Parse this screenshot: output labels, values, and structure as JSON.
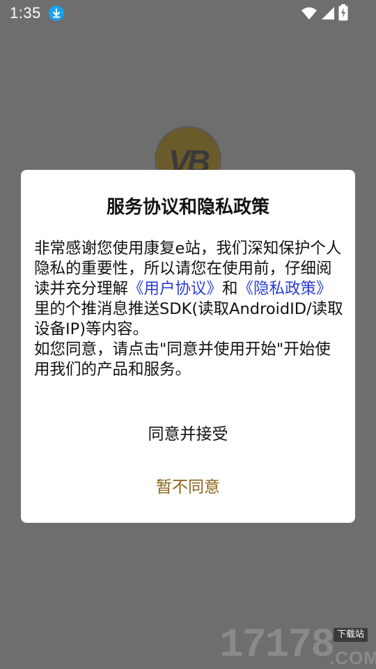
{
  "status_bar": {
    "time": "1:35"
  },
  "background_logo": {
    "text": "VB"
  },
  "dialog": {
    "title": "服务协议和隐私政策",
    "body": {
      "part1": "非常感谢您使用康复e站，我们深知保护个人隐私的重要性，所以请您在使用前，仔细阅读并充分理解",
      "link_user_agreement": "《用户协议》",
      "part2": "和",
      "link_privacy_policy": "《隐私政策》",
      "part3": "里的个推消息推送SDK(读取AndroidID/读取设备IP)等内容。",
      "part4": "如您同意，请点击\"同意并使用开始\"开始使用我们的产品和服务。"
    },
    "accept_label": "同意并接受",
    "decline_label": "暂不同意"
  },
  "watermark": {
    "digits": "17178",
    "tag": "下载站",
    "suffix": ".COM"
  },
  "colors": {
    "overlay_bg": "#6e6e6e",
    "link": "#2b3fd6",
    "decline": "#8a6318",
    "download_badge": "#1aa3f0"
  }
}
